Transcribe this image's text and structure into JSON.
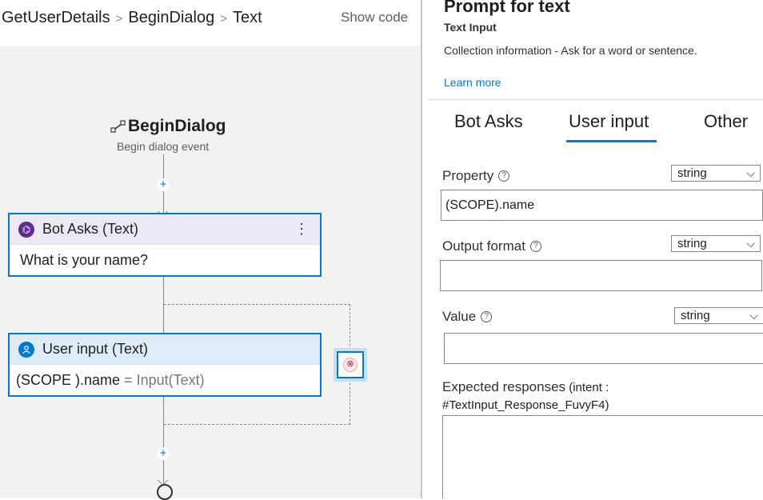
{
  "breadcrumb": {
    "items": [
      "GetUserDetails",
      "BeginDialog",
      "Text"
    ]
  },
  "show_code_label": "Show code",
  "canvas": {
    "begin_title": "BeginDialog",
    "begin_subtitle": "Begin dialog event",
    "add_label": "+",
    "bot_asks": {
      "title": "Bot Asks (Text)",
      "menu": "⋮",
      "body": "What is your name?"
    },
    "user_input": {
      "title": "User input (Text)",
      "body_var": "(SCOPE ).name",
      "body_op": " = ",
      "body_expr": "Input(Text)"
    },
    "error_glyph": "⊗"
  },
  "panel": {
    "title": "Prompt for text",
    "subtitle": "Text Input",
    "description": "Collection information - Ask for a word or sentence.",
    "learn_more": "Learn more",
    "tabs": [
      {
        "label": "Bot Asks"
      },
      {
        "label": "User input"
      },
      {
        "label": "Other"
      }
    ],
    "active_tab": "User input",
    "fields": {
      "property": {
        "label": "Property",
        "type": "string",
        "value": "(SCOPE).name"
      },
      "output_format": {
        "label": "Output format",
        "type": "string",
        "value": ""
      },
      "value": {
        "label": "Value",
        "type": "string",
        "value": ""
      }
    },
    "help_glyph": "?",
    "chevron_glyph": "⌵",
    "expected": {
      "label": "Expected responses",
      "intent_prefix": " (intent :",
      "intent_id": "#TextInput_Response_FuvyF4)"
    }
  },
  "colors": {
    "accent": "#0078d4",
    "canvas_bg": "#f3f2f1",
    "bot_asks_header": "#ede8f6",
    "user_input_header": "#deecf9"
  }
}
